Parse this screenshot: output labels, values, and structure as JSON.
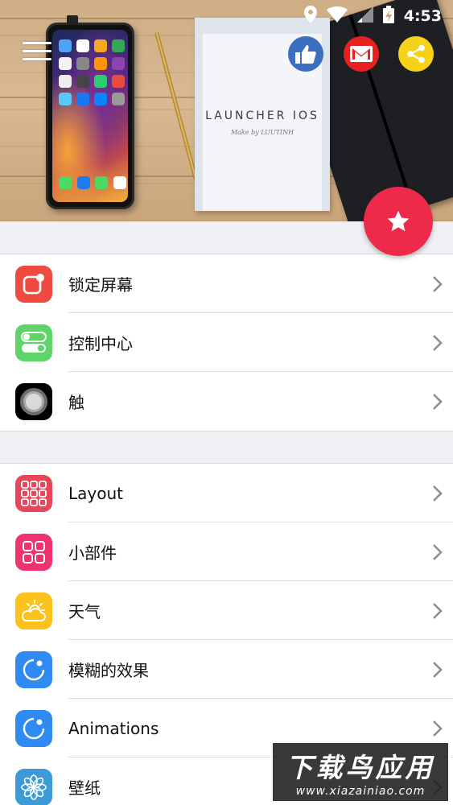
{
  "status_bar": {
    "time": "4:53"
  },
  "header": {
    "booklet_title": "LAUNCHER IOS",
    "booklet_subtitle": "Make by LUUTINH"
  },
  "social_buttons": [
    {
      "icon": "thumbs-up-icon",
      "color": "#3b6fc0"
    },
    {
      "icon": "mail-icon",
      "color": "#e8201f"
    },
    {
      "icon": "share-icon",
      "color": "#f7d21a"
    }
  ],
  "fab": {
    "icon": "star-icon",
    "color": "#ee2a4a"
  },
  "section1": {
    "items": [
      {
        "label": "锁定屏幕",
        "icon": "lock-screen-icon",
        "color": "#ee4a3f"
      },
      {
        "label": "控制中心",
        "icon": "toggle-switch-icon",
        "color": "#5fd468"
      },
      {
        "label": "触",
        "icon": "assistive-touch-icon",
        "color": "#000000"
      }
    ]
  },
  "section2": {
    "items": [
      {
        "label": "Layout",
        "icon": "grid-layout-icon",
        "color": "#e8475a"
      },
      {
        "label": "小部件",
        "icon": "widgets-icon",
        "color": "#f0336e"
      },
      {
        "label": "天气",
        "icon": "weather-icon",
        "color": "#fcc21b"
      },
      {
        "label": "模糊的效果",
        "icon": "blur-effect-icon",
        "color": "#2f8af2"
      },
      {
        "label": "Animations",
        "icon": "animation-icon",
        "color": "#2f8af2"
      },
      {
        "label": "壁纸",
        "icon": "wallpaper-flower-icon",
        "color": "#3b9bd6"
      }
    ]
  },
  "watermark": {
    "line1": "下载鸟应用",
    "line2": "www.xiazainiao.com"
  }
}
